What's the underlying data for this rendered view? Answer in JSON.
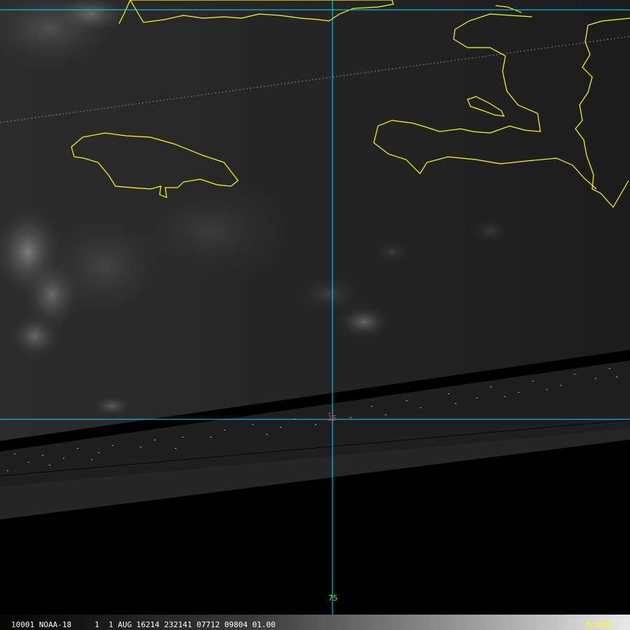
{
  "image": {
    "description_colors": {
      "coastline": "#ffff00",
      "grid": "#00e5ff",
      "lat_label": "#ff2020",
      "lon_label": "#33ff33"
    },
    "grid_labels": {
      "latitude": "15",
      "longitude": "75"
    }
  },
  "status_bar": {
    "frame_digit": "1",
    "text": "0001 NOAA-18     1  1 AUG 16214 232141 07712 09804 01.00",
    "brand": "McIDAS"
  }
}
